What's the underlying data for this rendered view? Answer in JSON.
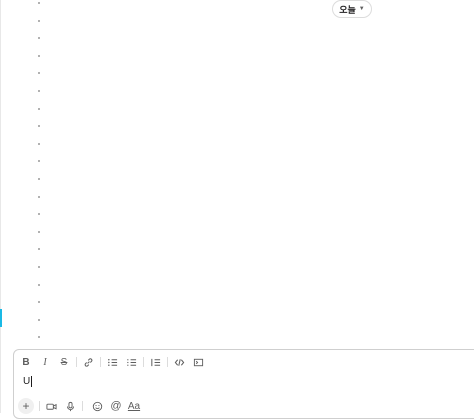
{
  "header": {
    "date_label": "오늘"
  },
  "timeline": {
    "bullet_count": 20
  },
  "composer": {
    "text": "U",
    "toolbar": [
      {
        "name": "bold-button",
        "glyph": "B"
      },
      {
        "name": "italic-button",
        "glyph": "I"
      },
      {
        "name": "strikethrough-button",
        "glyph": "S"
      }
    ],
    "format_label": "Aa"
  },
  "colors": {
    "accent": "#1ab9e5"
  }
}
